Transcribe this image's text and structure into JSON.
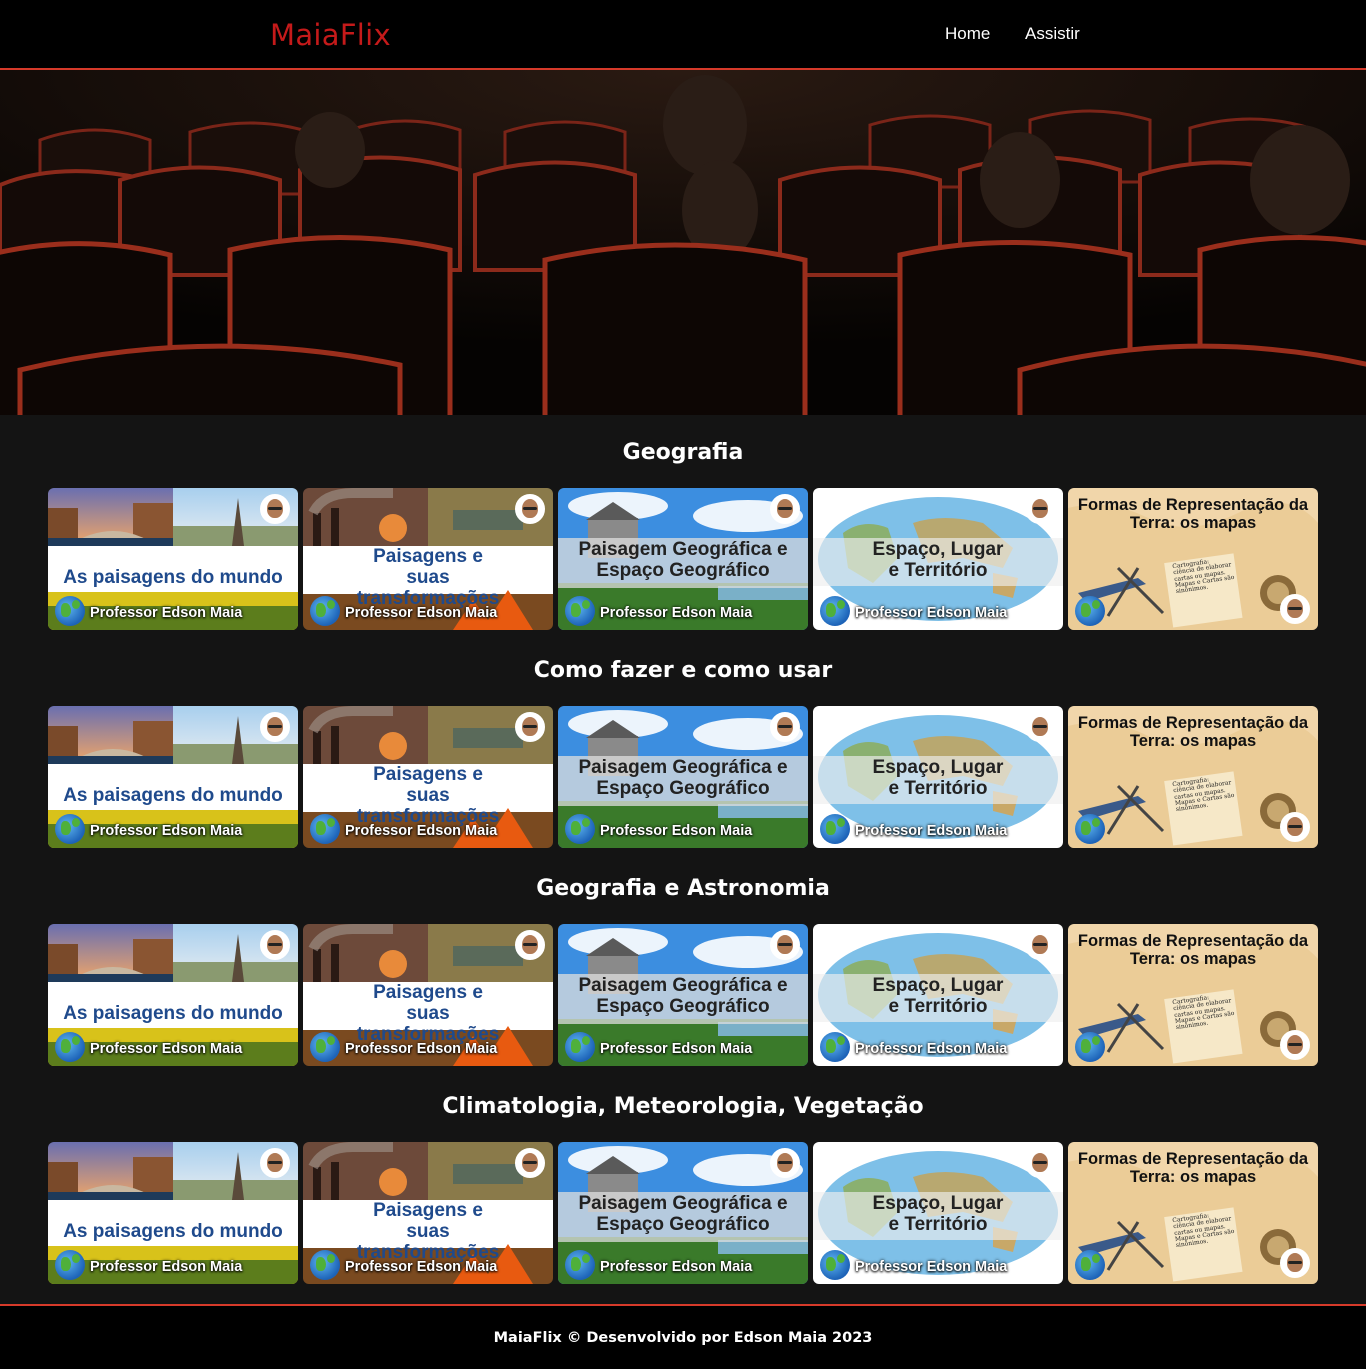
{
  "brand": {
    "name": "MaiaFlix",
    "color": "#c51a1a",
    "accent": "#d63a2a"
  },
  "nav": {
    "items": [
      "Home",
      "Assistir"
    ]
  },
  "hero": {
    "image": "cinema-seats-photo"
  },
  "sections": [
    {
      "title": "Geografia"
    },
    {
      "title": "Como fazer e como usar"
    },
    {
      "title": "Geografia e Astronomia"
    },
    {
      "title": "Climatologia, Meteorologia, Vegetação"
    }
  ],
  "videos": [
    {
      "title": "As paisagens do mundo",
      "author": "Professor Edson Maia"
    },
    {
      "title": "Paisagens e suas transformações",
      "author": "Professor Edson Maia"
    },
    {
      "title": "Paisagem Geográfica e Espaço Geográfico",
      "author": "Professor Edson Maia"
    },
    {
      "title": "Espaço, Lugar e Território",
      "author": "Professor Edson Maia"
    },
    {
      "title": "Formas de Representação da Terra: os mapas",
      "note": "Cartografia: ciência de elaborar cartas ou mapas. Mapas e Cartas são sinônimos."
    }
  ],
  "footer": {
    "text": "MaiaFlix © Desenvolvido por Edson Maia 2023"
  }
}
